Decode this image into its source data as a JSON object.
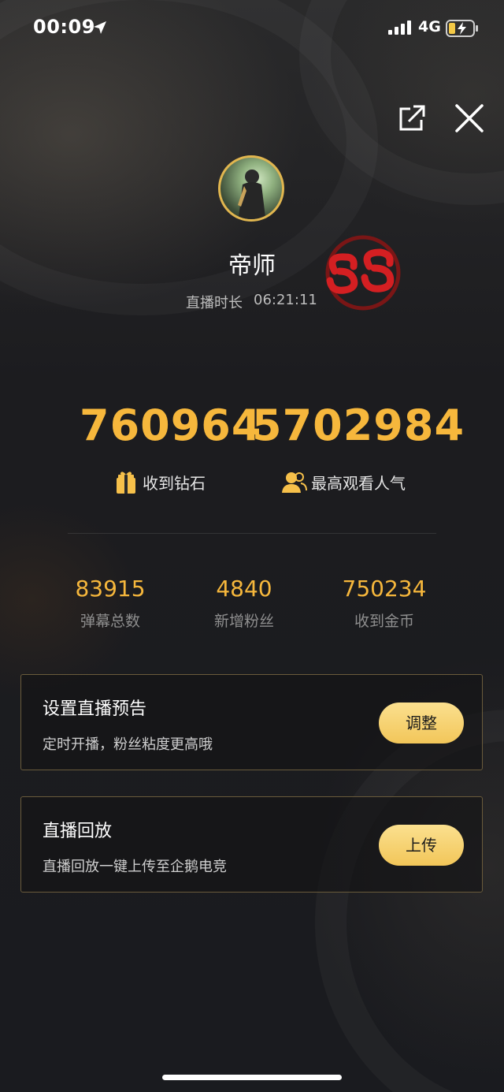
{
  "status_bar": {
    "time": "00:09",
    "network": "4G"
  },
  "profile": {
    "name": "帝师",
    "duration_label": "直播时长",
    "duration_value": "06:21:11"
  },
  "summary": {
    "diamonds_value": "760964",
    "diamonds_label": "收到钻石",
    "peak_value": "5702984",
    "peak_label": "最高观看人气"
  },
  "stats": [
    {
      "value": "83915",
      "label": "弹幕总数"
    },
    {
      "value": "4840",
      "label": "新增粉丝"
    },
    {
      "value": "750234",
      "label": "收到金币"
    }
  ],
  "cards": [
    {
      "title": "设置直播预告",
      "desc": "定时开播，粉丝粘度更高哦",
      "button": "调整"
    },
    {
      "title": "直播回放",
      "desc": "直播回放一键上传至企鹅电竞",
      "button": "上传"
    }
  ],
  "colors": {
    "accent": "#f6b73c",
    "button": "#f5cd63",
    "card_border": "#6a5b3b"
  },
  "icons": [
    "location-icon",
    "signal-icon",
    "battery-icon",
    "share-icon",
    "close-icon",
    "gift-icon",
    "people-icon",
    "logo-ss"
  ]
}
